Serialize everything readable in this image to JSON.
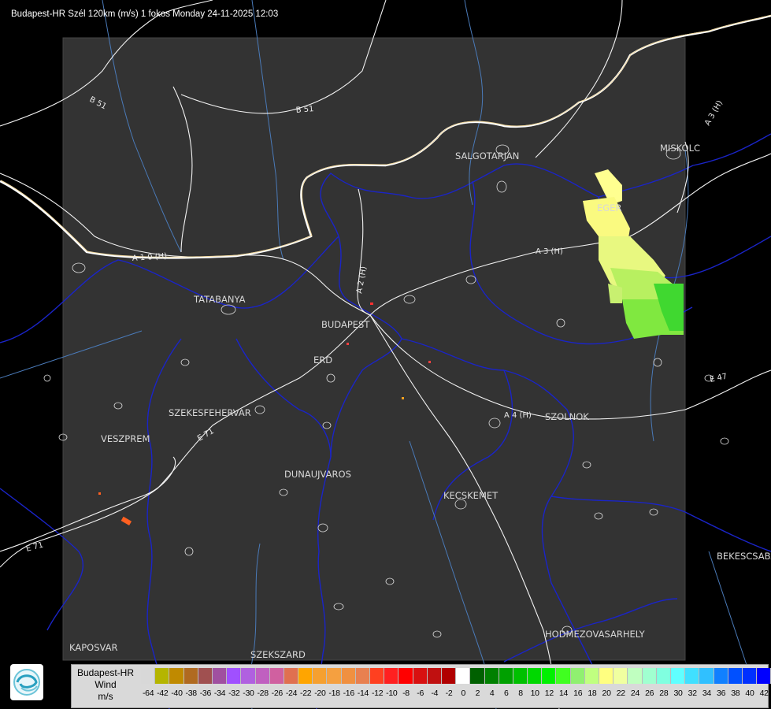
{
  "title": "Budapest-HR Szél 120km (m/s) 1 fokos Monday 24-11-2025 12:03",
  "cities": [
    "SALGOTARJAN",
    "EGER",
    "MISKOLC",
    "TATABANYA",
    "BUDAPEST",
    "ERD",
    "SZEKESFEHERVAR",
    "VESZPREM",
    "DUNAUJVAROS",
    "SZOLNOK",
    "KECSKEMET",
    "HODMEZOVASARHELY",
    "BEKESCSABA",
    "KAPOSVAR",
    "SZEKSZARD"
  ],
  "roads": [
    "B 51",
    "B 51",
    "A 1 0 (H)",
    "A 2 (H)",
    "A 3 (H)",
    "A 3 (H)",
    "E 71",
    "E 47",
    "A 4 (H)",
    "E 71"
  ],
  "legend": {
    "title_lines": [
      "Budapest-HR",
      "Wind",
      "m/s"
    ],
    "ticks": [
      "-64",
      "-42",
      "-40",
      "-38",
      "-36",
      "-34",
      "-32",
      "-30",
      "-28",
      "-26",
      "-24",
      "-22",
      "-20",
      "-18",
      "-16",
      "-14",
      "-12",
      "-10",
      "-8",
      "-6",
      "-4",
      "-2",
      "0",
      "2",
      "4",
      "6",
      "8",
      "10",
      "12",
      "14",
      "16",
      "18",
      "20",
      "22",
      "24",
      "26",
      "28",
      "30",
      "32",
      "34",
      "36",
      "38",
      "40",
      "42"
    ],
    "colors": [
      "#d8d8d8",
      "#b5b500",
      "#c08a00",
      "#b06a20",
      "#a05050",
      "#a050a0",
      "#a050ff",
      "#b060e0",
      "#c060c0",
      "#d060a0",
      "#e07050",
      "#ffa500",
      "#f5a030",
      "#f5a040",
      "#f09040",
      "#e88050",
      "#ff4020",
      "#ff2020",
      "#ff0000",
      "#d81010",
      "#c01010",
      "#b00000",
      "#ffffff",
      "#006000",
      "#008000",
      "#00a000",
      "#00c000",
      "#00d800",
      "#00f000",
      "#40ff20",
      "#90f070",
      "#c0ff80",
      "#ffff80",
      "#f0ffa0",
      "#c0ffc0",
      "#a0ffd0",
      "#80ffe0",
      "#60ffff",
      "#40e0ff",
      "#30c0ff",
      "#1080ff",
      "#0050ff",
      "#0030ff",
      "#0000ff"
    ]
  }
}
